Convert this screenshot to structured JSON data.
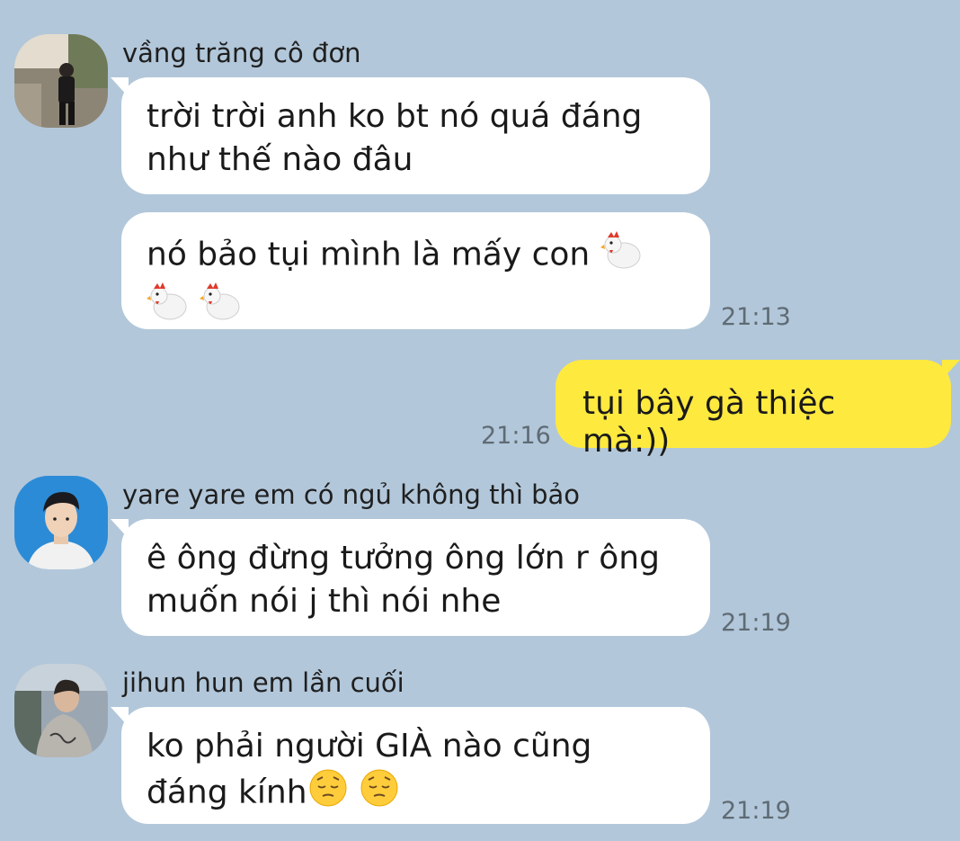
{
  "messages": [
    {
      "sender": "vầng trăng cô đơn",
      "bubbles": [
        {
          "line1": "trời trời anh ko bt nó quá đáng",
          "line2": "như thế nào đâu"
        },
        {
          "line1": "nó bảo tụi mình là mấy con",
          "emoji": "chicken-emoji"
        }
      ],
      "time": "21:13"
    },
    {
      "outgoing": true,
      "text": "tụi bây gà thiệc mà:))",
      "time": "21:16"
    },
    {
      "sender": "yare yare em có ngủ không thì bảo",
      "bubbles": [
        {
          "line1": "ê ông đừng tưởng ông lớn r ông",
          "line2": "muốn nói j thì nói nhe"
        }
      ],
      "time": "21:19"
    },
    {
      "sender": "jihun hun em lần cuối",
      "bubbles": [
        {
          "line1": "ko phải người GIÀ nào cũng",
          "line2": "đáng kính",
          "emoji": "pensive-face-emoji"
        }
      ],
      "time": "21:19"
    }
  ],
  "colors": {
    "background": "#b2c7da",
    "incoming_bubble": "#ffffff",
    "outgoing_bubble": "#fee93f"
  }
}
